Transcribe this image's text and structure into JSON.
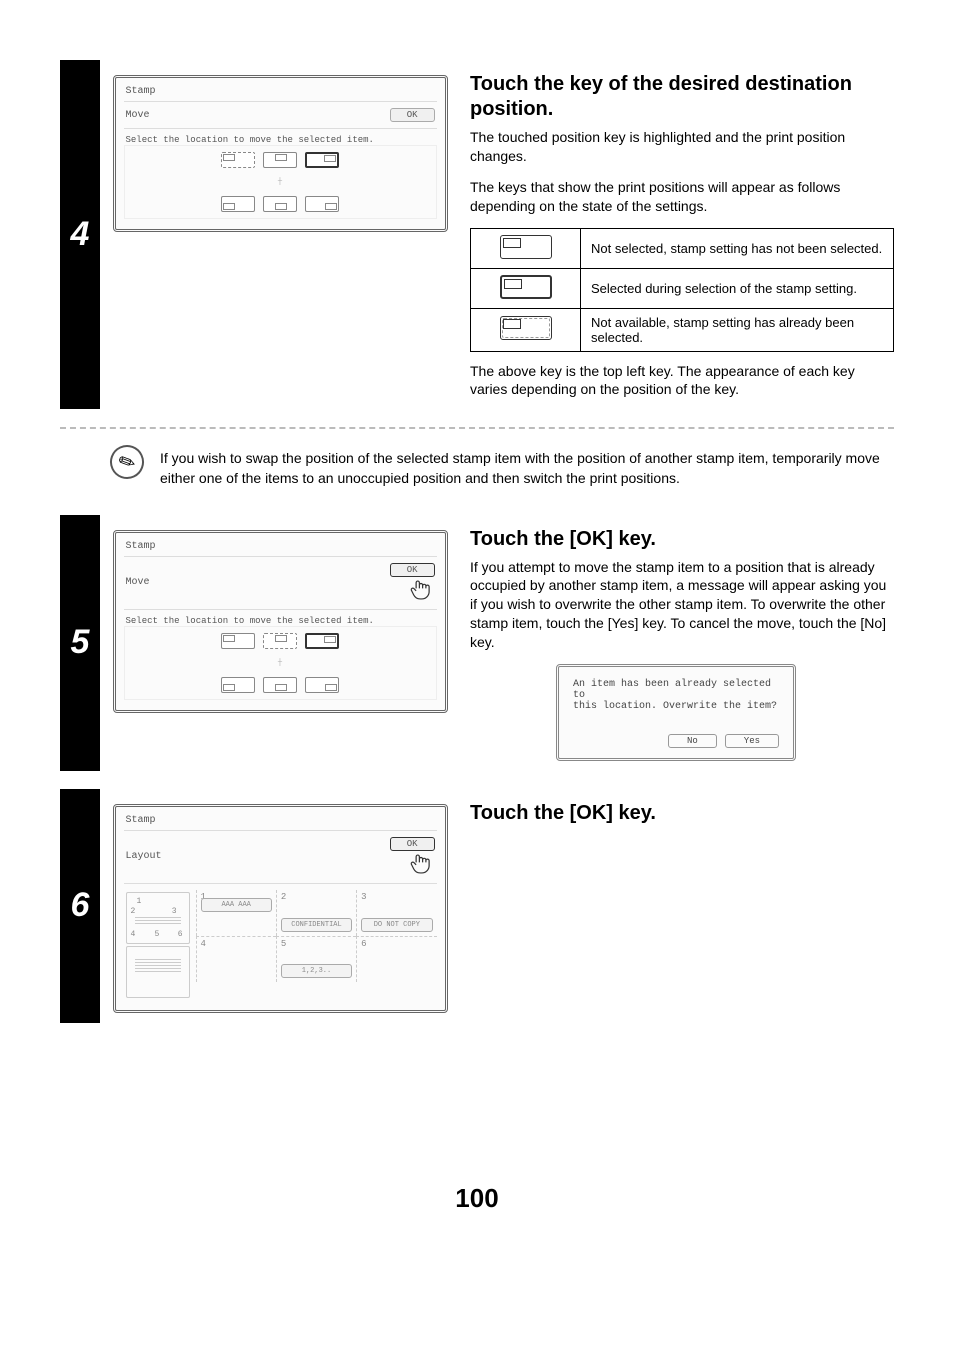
{
  "page_number": "100",
  "step4": {
    "number": "4",
    "heading": "Touch the key of the desired destination position.",
    "p1": "The touched position key is highlighted and the print position changes.",
    "p2": "The keys that show the print positions will appear as follows depending on the state of the settings.",
    "state_rows": [
      "Not selected, stamp setting has not been selected.",
      "Selected during selection of the stamp setting.",
      "Not available, stamp setting has already been selected."
    ],
    "p3": "The above key is the top left key. The appearance of each key varies depending on the position of the key.",
    "panel": {
      "title": "Stamp",
      "sub": "Move",
      "ok": "OK",
      "msg": "Select the location to move the selected item."
    }
  },
  "note": {
    "text": "If you wish to swap the position of the selected stamp item with the position of another stamp item, temporarily move either one of the items to an unoccupied position and then switch the print positions."
  },
  "step5": {
    "number": "5",
    "heading": "Touch the [OK] key.",
    "p1": "If you attempt to move the stamp item to a position that is already occupied by another stamp item, a message will appear asking you if you wish to overwrite the other stamp item. To overwrite the other stamp item, touch the [Yes] key. To cancel the move, touch the [No] key.",
    "panel": {
      "title": "Stamp",
      "sub": "Move",
      "ok": "OK",
      "msg": "Select the location to move the selected item."
    },
    "popup": {
      "line1": "An item has been already selected to",
      "line2": "this location. Overwrite the item?",
      "no": "No",
      "yes": "Yes"
    }
  },
  "step6": {
    "number": "6",
    "heading": "Touch the [OK] key.",
    "panel": {
      "title": "Stamp",
      "sub": "Layout",
      "ok": "OK",
      "zones": {
        "z1": {
          "num": "1",
          "btn": "AAA AAA"
        },
        "z2": {
          "num": "2",
          "btn": "CONFIDENTIAL"
        },
        "z3": {
          "num": "3",
          "btn": "DO NOT COPY"
        },
        "z4": {
          "num": "4"
        },
        "z5": {
          "num": "5",
          "btn": "1,2,3.."
        },
        "z6": {
          "num": "6"
        }
      },
      "thumb": {
        "n1": "1",
        "n2": "2",
        "n3": "3",
        "n4": "4",
        "n5": "5",
        "n6": "6"
      }
    }
  }
}
